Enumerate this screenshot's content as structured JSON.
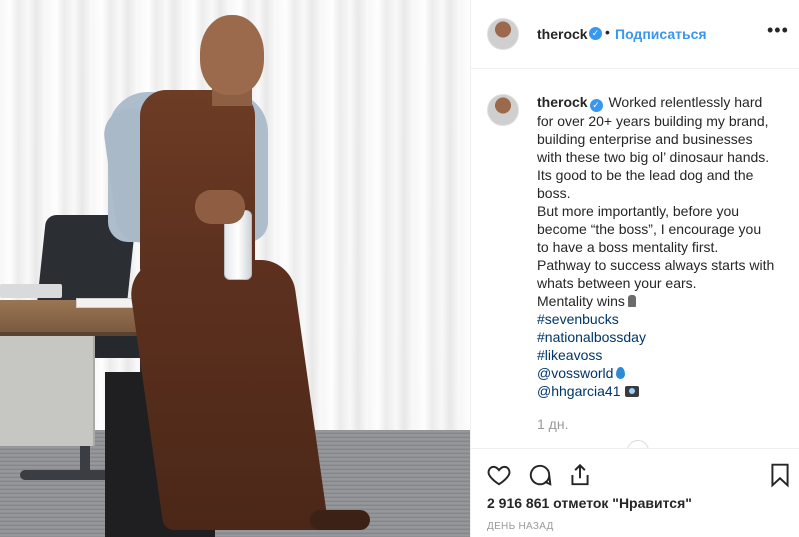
{
  "post": {
    "username": "therock",
    "verified_mark": "✓",
    "separator": "•",
    "follow_label": "Подписаться",
    "more_label": "•••",
    "image_alt": "",
    "caption": {
      "username": "therock",
      "lines": [
        "Worked relentlessly hard",
        "for over 20+ years building my brand,",
        "building enterprise and businesses",
        "with these two big ol’ dinosaur hands.",
        "Its good to be the lead dog and the",
        "boss.",
        "But more importantly, before you",
        "become “the boss”, I encourage you",
        "to have a boss mentality first.",
        "Pathway to success always starts with",
        "whats between your ears."
      ],
      "last_line": "Mentality wins",
      "hashtags": [
        "#sevenbucks",
        "#nationalbossday",
        "#likeavoss"
      ],
      "mentions": [
        {
          "text": "@vossworld",
          "emoji": "droplet"
        },
        {
          "text": "@hhgarcia41",
          "emoji": "camera"
        }
      ]
    },
    "time_ago": "1 дн.",
    "likes_text": "2 916 861 отметок \"Нравится\"",
    "date_text": "ДЕНЬ НАЗАД",
    "icons": {
      "like": "heart-icon",
      "comment": "comment-icon",
      "share": "share-icon",
      "save": "bookmark-icon"
    },
    "colors": {
      "accent": "#3897f0",
      "text": "#262626",
      "muted": "#999999",
      "tag": "#003569"
    }
  }
}
